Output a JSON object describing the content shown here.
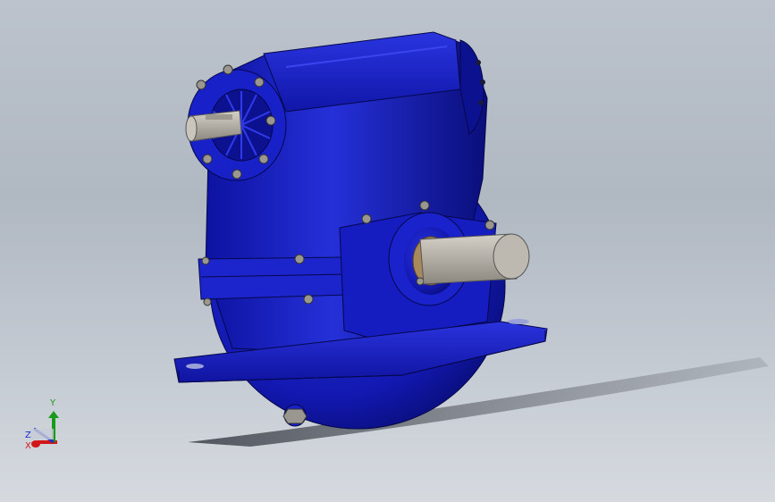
{
  "triad": {
    "x_label": "X",
    "y_label": "Y",
    "z_label": "Z"
  },
  "colors": {
    "background_top": "#bcc3cc",
    "background_bottom": "#d6dadf",
    "housing": "#1a1fb0",
    "housing_dark": "#0b0f6e",
    "shaft": "#b8b3ab",
    "bronze": "#a8895c",
    "x_axis": "#d01818",
    "y_axis": "#1a9a1a",
    "z_axis": "#1a2ad0"
  },
  "icons": {
    "triad": "coordinate-triad-icon"
  }
}
